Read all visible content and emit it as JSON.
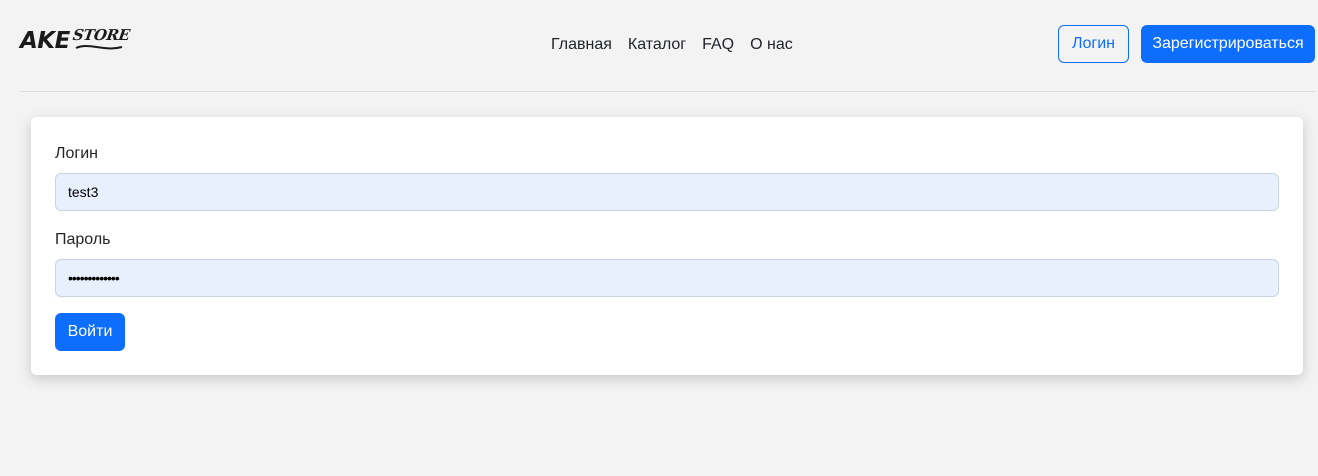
{
  "header": {
    "logo_main": "AKE",
    "logo_sub": "STORE",
    "nav": [
      "Главная",
      "Каталог",
      "FAQ",
      "О нас"
    ],
    "login_button": "Логин",
    "register_button": "Зарегистрироваться"
  },
  "form": {
    "login_label": "Логин",
    "login_value": "test3",
    "password_label": "Пароль",
    "password_value": "•••••••••••••",
    "submit_label": "Войти"
  },
  "colors": {
    "primary": "#0d6efd",
    "autofill_bg": "#e8f0fe",
    "page_bg": "#f3f3f3"
  }
}
